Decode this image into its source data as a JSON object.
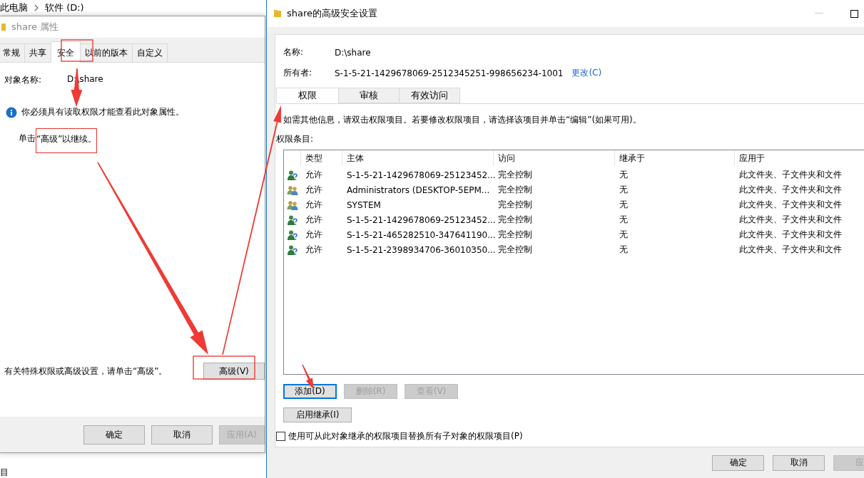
{
  "explorer": {
    "breadcrumb": [
      "此电脑",
      "软件 (D:)"
    ],
    "fragment": "目"
  },
  "properties_dialog": {
    "title": "share 属性",
    "tabs": [
      {
        "label": "常规",
        "selected": false
      },
      {
        "label": "共享",
        "selected": false
      },
      {
        "label": "安全",
        "selected": true
      },
      {
        "label": "以前的版本",
        "selected": false
      },
      {
        "label": "自定义",
        "selected": false
      }
    ],
    "object_name_label": "对象名称:",
    "object_name": "D:\\share",
    "info": "你必须具有读取权限才能查看此对象属性。",
    "hint": {
      "text": "单击",
      "highlighted": "“高级”以继续。"
    },
    "advanced_hint": "有关特殊权限或高级设置，请单击“高级”。",
    "advanced_button": "高级(V)",
    "buttons": [
      {
        "label": "确定",
        "disabled": false
      },
      {
        "label": "取消",
        "disabled": false
      },
      {
        "label": "应用(A)",
        "disabled": true
      }
    ]
  },
  "advanced_dialog": {
    "title": "share的高级安全设置",
    "name_label": "名称:",
    "name": "D:\\share",
    "owner_label": "所有者:",
    "owner": "S-1-5-21-1429678069-2512345251-998656234-1001",
    "change_link": "更改(C)",
    "tabs": [
      {
        "label": "权限",
        "selected": true
      },
      {
        "label": "审核",
        "selected": false
      },
      {
        "label": "有效访问",
        "selected": false
      }
    ],
    "info": "如需其他信息，请双击权限项目。若要修改权限项目，请选择该项目并单击“编辑”(如果可用)。",
    "entries_label": "权限条目:",
    "table": {
      "columns": [
        "类型",
        "主体",
        "访问",
        "继承于",
        "应用于"
      ],
      "rows": [
        {
          "kind": "unknown",
          "type": "允许",
          "principal": "S-1-5-21-1429678069-25123452...",
          "access": "完全控制",
          "inherited_from": "无",
          "applies_to": "此文件夹、子文件夹和文件"
        },
        {
          "kind": "group",
          "type": "允许",
          "principal": "Administrators (DESKTOP-5EPM...",
          "access": "完全控制",
          "inherited_from": "无",
          "applies_to": "此文件夹、子文件夹和文件"
        },
        {
          "kind": "group",
          "type": "允许",
          "principal": "SYSTEM",
          "access": "完全控制",
          "inherited_from": "无",
          "applies_to": "此文件夹、子文件夹和文件"
        },
        {
          "kind": "unknown",
          "type": "允许",
          "principal": "S-1-5-21-1429678069-25123452...",
          "access": "完全控制",
          "inherited_from": "无",
          "applies_to": "此文件夹、子文件夹和文件"
        },
        {
          "kind": "unknown",
          "type": "允许",
          "principal": "S-1-5-21-465282510-347641190...",
          "access": "完全控制",
          "inherited_from": "无",
          "applies_to": "此文件夹、子文件夹和文件"
        },
        {
          "kind": "unknown",
          "type": "允许",
          "principal": "S-1-5-21-2398934706-36010350...",
          "access": "完全控制",
          "inherited_from": "无",
          "applies_to": "此文件夹、子文件夹和文件"
        }
      ]
    },
    "actions": [
      {
        "label": "添加(D)",
        "disabled": false,
        "focused": true
      },
      {
        "label": "删除(R)",
        "disabled": true,
        "focused": false
      },
      {
        "label": "查看(V)",
        "disabled": true,
        "focused": false
      }
    ],
    "inherit_button": "启用继承(I)",
    "replace_checkbox": {
      "label": "使用可从此对象继承的权限项目替换所有子对象的权限项目(P)",
      "checked": false
    },
    "buttons": [
      {
        "label": "确定",
        "disabled": false
      },
      {
        "label": "取消",
        "disabled": false
      },
      {
        "label": "应",
        "disabled": true
      }
    ]
  }
}
